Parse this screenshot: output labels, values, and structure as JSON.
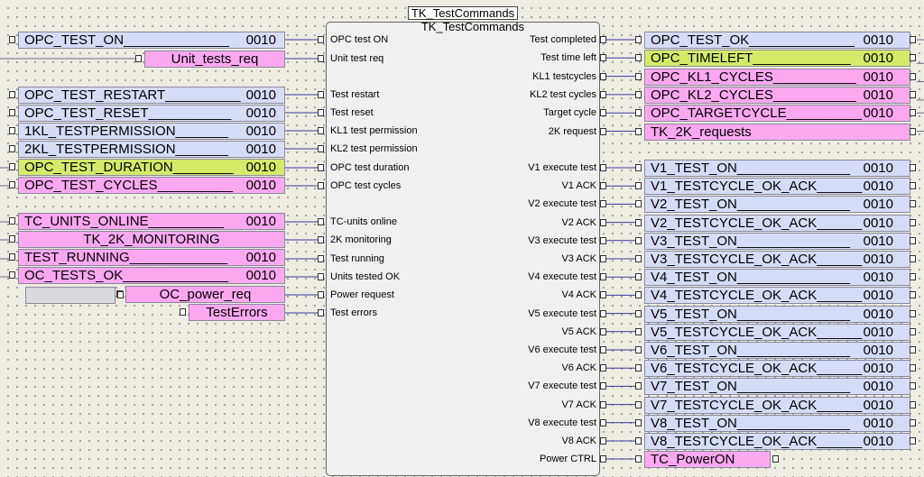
{
  "block": {
    "title": "TK_TestCommands",
    "instance": "TK_TestCommands"
  },
  "inputs": [
    "OPC test ON",
    "Unit test req",
    "Test restart",
    "Test reset",
    "KL1 test permission",
    "KL2 test permission",
    "OPC test duration",
    "OPC test cycles",
    "TC-units online",
    "2K monitoring",
    "Test running",
    "Units tested OK",
    "Power request",
    "Test errors"
  ],
  "outputs": [
    "Test completed",
    "Test time left",
    "KL1 testcycles",
    "KL2 test cycles",
    "Target cycle",
    "2K request",
    "V1 execute test",
    "V1 ACK",
    "V2 execute test",
    "V2 ACK",
    "V3 execute test",
    "V3 ACK",
    "V4 execute test",
    "V4 ACK",
    "V5 execute test",
    "V5 ACK",
    "V6 execute test",
    "V6 ACK",
    "V7 execute test",
    "V7 ACK",
    "V8 execute test",
    "V8 ACK",
    "Power CTRL"
  ],
  "left_vars": [
    {
      "name": "OPC_TEST_ON______________",
      "tag": "0010",
      "color": "blue"
    },
    {
      "name": "Unit_tests_req",
      "tag": "",
      "color": "pink"
    },
    {
      "name": "OPC_TEST_RESTART__________",
      "tag": "0010",
      "color": "blue"
    },
    {
      "name": "OPC_TEST_RESET___________",
      "tag": "0010",
      "color": "blue"
    },
    {
      "name": "1KL_TESTPERMISSION_______",
      "tag": "0010",
      "color": "blue"
    },
    {
      "name": "2KL_TESTPERMISSION_______",
      "tag": "0010",
      "color": "blue"
    },
    {
      "name": "OPC_TEST_DURATION________",
      "tag": "0010",
      "color": "yellow"
    },
    {
      "name": "OPC_TEST_CYCLES__________",
      "tag": "0010",
      "color": "pink"
    },
    {
      "name": "TC_UNITS_ONLINE__________",
      "tag": "0010",
      "color": "pink"
    },
    {
      "name": "TK_2K_MONITORING",
      "tag": "",
      "color": "pink"
    },
    {
      "name": "TEST_RUNNING_____________",
      "tag": "0010",
      "color": "pink"
    },
    {
      "name": "OC_TESTS_OK______________",
      "tag": "0010",
      "color": "pink"
    },
    {
      "name": "OC_power_req",
      "tag": "",
      "color": "pink"
    },
    {
      "name": "TestErrors",
      "tag": "",
      "color": "pink"
    }
  ],
  "right_vars": [
    {
      "name": "OPC_TEST_OK______________",
      "tag": "0010",
      "color": "blue"
    },
    {
      "name": "OPC_TIMELEFT_____________",
      "tag": "0010",
      "color": "yellow"
    },
    {
      "name": "OPC_KL1_CYCLES___________",
      "tag": "0010",
      "color": "pink"
    },
    {
      "name": "OPC_KL2_CYCLES___________",
      "tag": "0010",
      "color": "pink"
    },
    {
      "name": "OPC_TARGETCYCLE__________",
      "tag": "0010",
      "color": "pink"
    },
    {
      "name": "TK_2K_requests",
      "tag": "",
      "color": "pink"
    },
    {
      "name": "V1_TEST_ON_______________",
      "tag": "0010",
      "color": "blue"
    },
    {
      "name": "V1_TESTCYCLE_OK_ACK______",
      "tag": "0010",
      "color": "blue"
    },
    {
      "name": "V2_TEST_ON_______________",
      "tag": "0010",
      "color": "blue"
    },
    {
      "name": "V2_TESTCYCLE_OK_ACK______",
      "tag": "0010",
      "color": "blue"
    },
    {
      "name": "V3_TEST_ON_______________",
      "tag": "0010",
      "color": "blue"
    },
    {
      "name": "V3_TESTCYCLE_OK_ACK______",
      "tag": "0010",
      "color": "blue"
    },
    {
      "name": "V4_TEST_ON_______________",
      "tag": "0010",
      "color": "blue"
    },
    {
      "name": "V4_TESTCYCLE_OK_ACK______",
      "tag": "0010",
      "color": "blue"
    },
    {
      "name": "V5_TEST_ON_______________",
      "tag": "0010",
      "color": "blue"
    },
    {
      "name": "V5_TESTCYCLE_OK_ACK______",
      "tag": "0010",
      "color": "blue"
    },
    {
      "name": "V6_TEST_ON_______________",
      "tag": "0010",
      "color": "blue"
    },
    {
      "name": "V6_TESTCYCLE_OK_ACK______",
      "tag": "0010",
      "color": "blue"
    },
    {
      "name": "V7_TEST_ON_______________",
      "tag": "0010",
      "color": "blue"
    },
    {
      "name": "V7_TESTCYCLE_OK_ACK______",
      "tag": "0010",
      "color": "blue"
    },
    {
      "name": "V8_TEST_ON_______________",
      "tag": "0010",
      "color": "blue"
    },
    {
      "name": "V8_TESTCYCLE_OK_ACK______",
      "tag": "0010",
      "color": "blue"
    },
    {
      "name": "TC_PowerON",
      "tag": "",
      "color": "pink"
    }
  ],
  "colors": {
    "blue": "#d5dcf6",
    "pink": "#fca8f0",
    "yellow": "#d4eb6a",
    "gray": "#d9d9dd",
    "wire": "#3a3aa0",
    "background": "#efece2"
  }
}
